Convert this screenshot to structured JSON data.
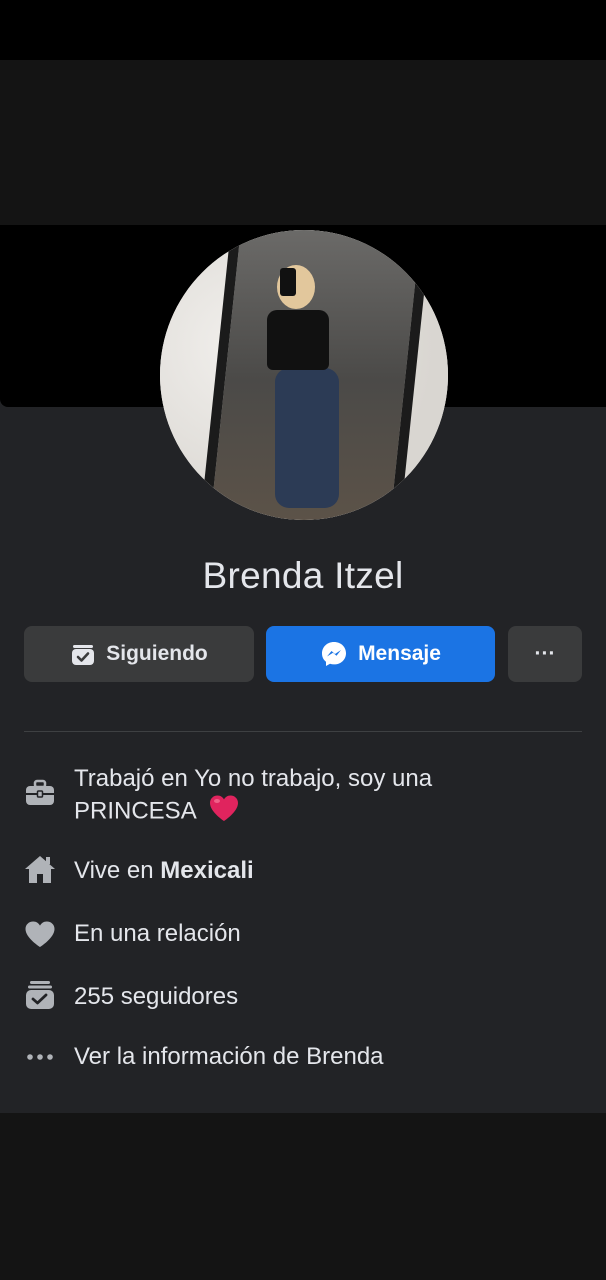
{
  "profile": {
    "name": "Brenda Itzel"
  },
  "actions": {
    "following_label": "Siguiendo",
    "message_label": "Mensaje",
    "more_label": "···"
  },
  "info": {
    "work_text": "Trabajó en Yo no trabajo, soy una",
    "work_text_line2": "PRINCESA",
    "lives_prefix": "Vive en",
    "lives_city": "Mexicali",
    "relationship": "En una relación",
    "followers": "255 seguidores",
    "see_info": "Ver la información de Brenda"
  },
  "icons": {
    "work": "briefcase-icon",
    "home": "home-icon",
    "relationship": "heart-icon",
    "followers": "followers-icon",
    "more": "more-dots-icon",
    "messenger": "messenger-icon",
    "following": "following-icon"
  },
  "colors": {
    "card_bg": "#222326",
    "primary": "#1b74e4",
    "secondary_btn": "#3a3b3c",
    "text": "#e4e6eb",
    "icon": "#b0b3b8",
    "heart_emoji": "#e0245e"
  }
}
